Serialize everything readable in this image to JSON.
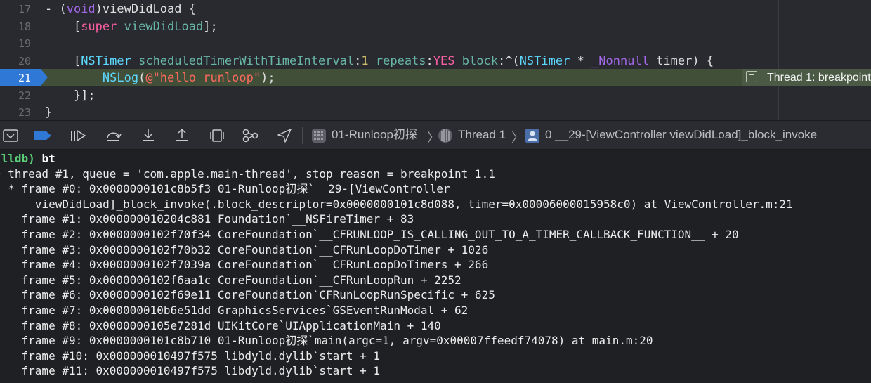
{
  "editor": {
    "line_numbers": [
      "17",
      "18",
      "19",
      "20",
      "21",
      "22",
      "23"
    ],
    "current_line": "21",
    "lines": [
      {
        "n": "17",
        "tokens": [
          [
            "plain",
            "- ("
          ],
          [
            "kwd",
            "void"
          ],
          [
            "plain",
            ")viewDidLoad {"
          ]
        ]
      },
      {
        "n": "18",
        "tokens": [
          [
            "plain",
            "    ["
          ],
          [
            "kw",
            "super"
          ],
          [
            "plain",
            " "
          ],
          [
            "fn",
            "viewDidLoad"
          ],
          [
            "plain",
            "];"
          ]
        ]
      },
      {
        "n": "19",
        "tokens": []
      },
      {
        "n": "20",
        "tokens": [
          [
            "plain",
            "    ["
          ],
          [
            "cls",
            "NSTimer"
          ],
          [
            "plain",
            " "
          ],
          [
            "mth",
            "scheduledTimerWithTimeInterval"
          ],
          [
            "plain",
            ":"
          ],
          [
            "num",
            "1"
          ],
          [
            "plain",
            " "
          ],
          [
            "mth",
            "repeats"
          ],
          [
            "plain",
            ":"
          ],
          [
            "kw",
            "YES"
          ],
          [
            "plain",
            " "
          ],
          [
            "mth",
            "block"
          ],
          [
            "plain",
            ":^("
          ],
          [
            "cls",
            "NSTimer"
          ],
          [
            "plain",
            " * "
          ],
          [
            "prm",
            "_Nonnull"
          ],
          [
            "plain",
            " timer) {"
          ]
        ]
      },
      {
        "n": "21",
        "tokens": [
          [
            "plain",
            "        "
          ],
          [
            "cls",
            "NSLog"
          ],
          [
            "plain",
            "("
          ],
          [
            "str",
            "@\"hello runloop\""
          ],
          [
            "plain",
            ");"
          ]
        ]
      },
      {
        "n": "22",
        "tokens": [
          [
            "plain",
            "    }];"
          ]
        ]
      },
      {
        "n": "23",
        "tokens": [
          [
            "plain",
            "}"
          ]
        ]
      }
    ],
    "thread_annotation": "Thread 1: breakpoint"
  },
  "debug_bar": {
    "buttons": [
      "hide-console-icon",
      "breakpoint-toggle-icon",
      "continue-icon",
      "step-over-icon",
      "step-into-icon",
      "step-out-icon",
      "view-hierarchy-icon",
      "memory-graph-icon",
      "location-icon"
    ],
    "breadcrumb": {
      "target": "01-Runloop初探",
      "thread": "Thread 1",
      "frame": "0 __29-[ViewController viewDidLoad]_block_invoke"
    },
    "colors": {
      "accent": "#2f78d6"
    }
  },
  "console": {
    "prompt": "(lldb)",
    "command": "bt",
    "lines": [
      "* thread #1, queue = 'com.apple.main-thread', stop reason = breakpoint 1.1",
      "  * frame #0: 0x0000000101c8b5f3 01-Runloop初探`__29-[ViewController",
      "      viewDidLoad]_block_invoke(.block_descriptor=0x0000000101c8d088, timer=0x00006000015958c0) at ViewController.m:21",
      "    frame #1: 0x000000010204c881 Foundation`__NSFireTimer + 83",
      "    frame #2: 0x0000000102f70f34 CoreFoundation`__CFRUNLOOP_IS_CALLING_OUT_TO_A_TIMER_CALLBACK_FUNCTION__ + 20",
      "    frame #3: 0x0000000102f70b32 CoreFoundation`__CFRunLoopDoTimer + 1026",
      "    frame #4: 0x0000000102f7039a CoreFoundation`__CFRunLoopDoTimers + 266",
      "    frame #5: 0x0000000102f6aa1c CoreFoundation`__CFRunLoopRun + 2252",
      "    frame #6: 0x0000000102f69e11 CoreFoundation`CFRunLoopRunSpecific + 625",
      "    frame #7: 0x000000010b6e51dd GraphicsServices`GSEventRunModal + 62",
      "    frame #8: 0x0000000105e7281d UIKitCore`UIApplicationMain + 140",
      "    frame #9: 0x0000000101c8b710 01-Runloop初探`main(argc=1, argv=0x00007ffeedf74078) at main.m:20",
      "    frame #10: 0x000000010497f575 libdyld.dylib`start + 1",
      "    frame #11: 0x000000010497f575 libdyld.dylib`start + 1"
    ]
  }
}
